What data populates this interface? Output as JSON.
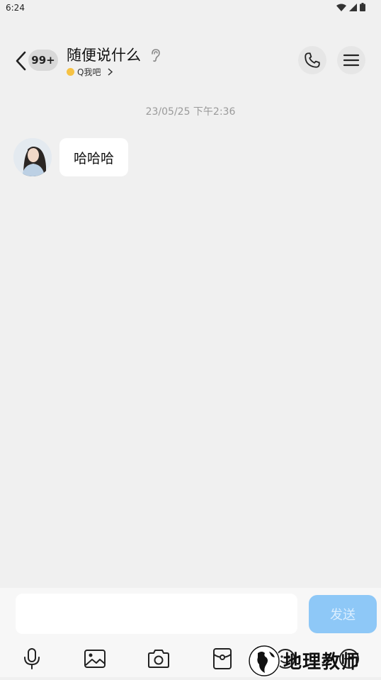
{
  "status": {
    "time": "6:24"
  },
  "header": {
    "unread_badge": "99+",
    "title": "随便说什么",
    "subtitle": "Q我吧"
  },
  "chat": {
    "timestamp": "23/05/25 下午2:36",
    "messages": [
      {
        "text": "哈哈哈"
      }
    ]
  },
  "input": {
    "value": "",
    "placeholder": "",
    "send_label": "发送"
  },
  "watermark": {
    "text": "地理教师"
  },
  "colors": {
    "send_button": "#8ec8f7",
    "background": "#f0f0f0",
    "bubble": "#ffffff"
  },
  "icons": [
    "back-arrow-icon",
    "ear-icon",
    "phone-icon",
    "menu-icon",
    "microphone-icon",
    "image-icon",
    "camera-icon",
    "red-packet-icon",
    "emoji-icon",
    "plus-icon"
  ]
}
